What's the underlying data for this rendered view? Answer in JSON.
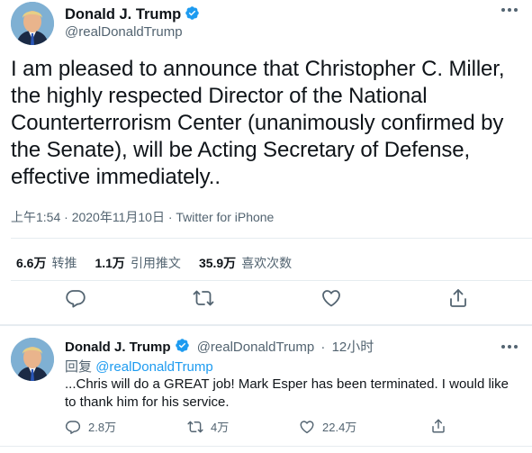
{
  "main_tweet": {
    "author_name": "Donald J. Trump",
    "author_handle": "@realDonaldTrump",
    "text": "I am pleased to announce that Christopher C. Miller, the highly respected Director of the National Counterterrorism Center (unanimously confirmed by the Senate), will be Acting Secretary of Defense, effective immediately..",
    "time": "上午1:54",
    "date": "2020年11月10日",
    "source": "Twitter for iPhone",
    "separator": " · ",
    "stats": [
      {
        "count": "6.6万",
        "label": "转推"
      },
      {
        "count": "1.1万",
        "label": "引用推文"
      },
      {
        "count": "35.9万",
        "label": "喜欢次数"
      }
    ],
    "actions": [
      "reply-icon",
      "retweet-icon",
      "like-icon",
      "share-icon"
    ]
  },
  "reply_tweet": {
    "author_name": "Donald J. Trump",
    "author_handle": "@realDonaldTrump",
    "dot": "·",
    "time": "12小时",
    "replying_label": "回复",
    "replying_handle": "@realDonaldTrump",
    "text": "...Chris will do a GREAT job! Mark Esper has been terminated. I would like to thank him for his service.",
    "replies": "2.8万",
    "retweets": "4万",
    "likes": "22.4万"
  },
  "colors": {
    "text": "#0f1419",
    "secondary": "#536471",
    "accent": "#1d9bf0",
    "divider": "#e6ecf0"
  }
}
